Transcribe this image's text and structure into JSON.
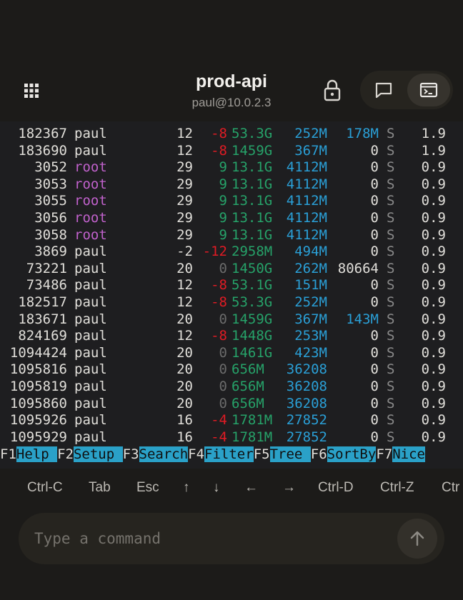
{
  "header": {
    "title": "prod-api",
    "subtitle": "paul@10.0.2.3",
    "icons": [
      "grid-icon",
      "lock-icon",
      "chat-icon",
      "terminal-icon"
    ]
  },
  "process_table": {
    "rows": [
      {
        "pid": "182367",
        "user": "paul",
        "pri": "12",
        "ni": "-8",
        "virt": "53.3G",
        "res": "252M",
        "shr": "178M",
        "s": "S",
        "cpu": "1.9"
      },
      {
        "pid": "183690",
        "user": "paul",
        "pri": "12",
        "ni": "-8",
        "virt": "1459G",
        "res": "367M",
        "shr": "0",
        "s": "S",
        "cpu": "1.9"
      },
      {
        "pid": "3052",
        "user": "root",
        "pri": "29",
        "ni": "9",
        "virt": "13.1G",
        "res": "4112M",
        "shr": "0",
        "s": "S",
        "cpu": "0.9"
      },
      {
        "pid": "3053",
        "user": "root",
        "pri": "29",
        "ni": "9",
        "virt": "13.1G",
        "res": "4112M",
        "shr": "0",
        "s": "S",
        "cpu": "0.9"
      },
      {
        "pid": "3055",
        "user": "root",
        "pri": "29",
        "ni": "9",
        "virt": "13.1G",
        "res": "4112M",
        "shr": "0",
        "s": "S",
        "cpu": "0.9"
      },
      {
        "pid": "3056",
        "user": "root",
        "pri": "29",
        "ni": "9",
        "virt": "13.1G",
        "res": "4112M",
        "shr": "0",
        "s": "S",
        "cpu": "0.9"
      },
      {
        "pid": "3058",
        "user": "root",
        "pri": "29",
        "ni": "9",
        "virt": "13.1G",
        "res": "4112M",
        "shr": "0",
        "s": "S",
        "cpu": "0.9"
      },
      {
        "pid": "3869",
        "user": "paul",
        "pri": "-2",
        "ni": "-12",
        "virt": "2958M",
        "res": "494M",
        "shr": "0",
        "s": "S",
        "cpu": "0.9"
      },
      {
        "pid": "73221",
        "user": "paul",
        "pri": "20",
        "ni": "0",
        "virt": "1450G",
        "res": "262M",
        "shr": "80664",
        "s": "S",
        "cpu": "0.9"
      },
      {
        "pid": "73486",
        "user": "paul",
        "pri": "12",
        "ni": "-8",
        "virt": "53.1G",
        "res": "151M",
        "shr": "0",
        "s": "S",
        "cpu": "0.9"
      },
      {
        "pid": "182517",
        "user": "paul",
        "pri": "12",
        "ni": "-8",
        "virt": "53.3G",
        "res": "252M",
        "shr": "0",
        "s": "S",
        "cpu": "0.9"
      },
      {
        "pid": "183671",
        "user": "paul",
        "pri": "20",
        "ni": "0",
        "virt": "1459G",
        "res": "367M",
        "shr": "143M",
        "s": "S",
        "cpu": "0.9"
      },
      {
        "pid": "824169",
        "user": "paul",
        "pri": "12",
        "ni": "-8",
        "virt": "1448G",
        "res": "253M",
        "shr": "0",
        "s": "S",
        "cpu": "0.9"
      },
      {
        "pid": "1094424",
        "user": "paul",
        "pri": "20",
        "ni": "0",
        "virt": "1461G",
        "res": "423M",
        "shr": "0",
        "s": "S",
        "cpu": "0.9"
      },
      {
        "pid": "1095816",
        "user": "paul",
        "pri": "20",
        "ni": "0",
        "virt": "656M",
        "res": "36208",
        "shr": "0",
        "s": "S",
        "cpu": "0.9"
      },
      {
        "pid": "1095819",
        "user": "paul",
        "pri": "20",
        "ni": "0",
        "virt": "656M",
        "res": "36208",
        "shr": "0",
        "s": "S",
        "cpu": "0.9"
      },
      {
        "pid": "1095860",
        "user": "paul",
        "pri": "20",
        "ni": "0",
        "virt": "656M",
        "res": "36208",
        "shr": "0",
        "s": "S",
        "cpu": "0.9"
      },
      {
        "pid": "1095926",
        "user": "paul",
        "pri": "16",
        "ni": "-4",
        "virt": "1781M",
        "res": "27852",
        "shr": "0",
        "s": "S",
        "cpu": "0.9"
      },
      {
        "pid": "1095929",
        "user": "paul",
        "pri": "16",
        "ni": "-4",
        "virt": "1781M",
        "res": "27852",
        "shr": "0",
        "s": "S",
        "cpu": "0.9"
      }
    ],
    "colors": {
      "root_user": "#c061cb",
      "negative_nice": "#e01b24",
      "virt": "#26a269",
      "res": "#2a9fd6",
      "fkey_bg": "#2aa1c8"
    }
  },
  "function_keys": [
    {
      "key": "F1",
      "label": "Help  "
    },
    {
      "key": "F2",
      "label": "Setup "
    },
    {
      "key": "F3",
      "label": "Search"
    },
    {
      "key": "F4",
      "label": "Filter"
    },
    {
      "key": "F5",
      "label": "Tree  "
    },
    {
      "key": "F6",
      "label": "SortBy"
    },
    {
      "key": "F7",
      "label": "Nice"
    }
  ],
  "shortcut_keys": [
    "Ctrl-C",
    "Tab",
    "Esc",
    "↑",
    "↓",
    "←",
    "→",
    "Ctrl-D",
    "Ctrl-Z",
    "Ctr"
  ],
  "command_input": {
    "placeholder": "Type a command",
    "value": ""
  }
}
